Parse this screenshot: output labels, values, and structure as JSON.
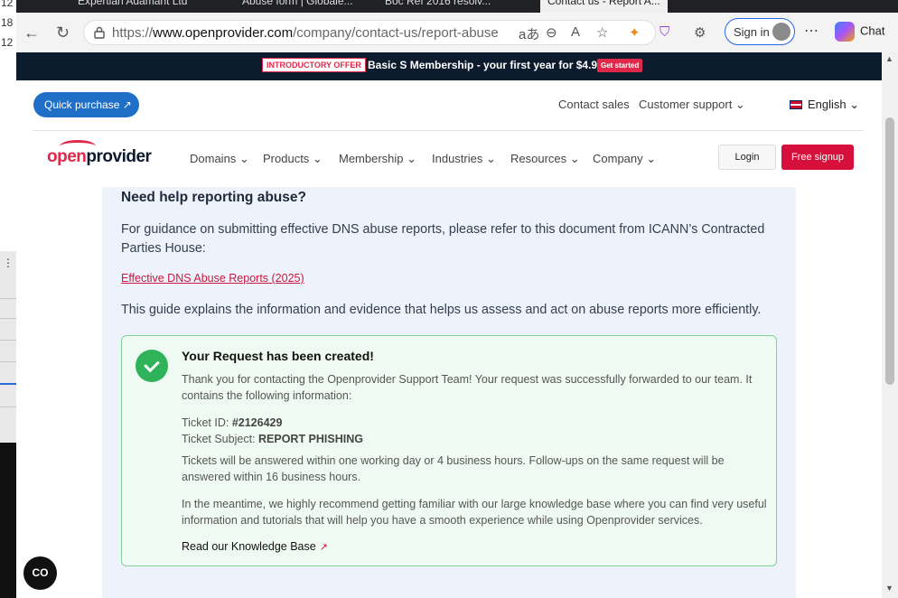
{
  "desktop": {
    "numbers": [
      "12",
      "18",
      "12"
    ],
    "dots": "⋮"
  },
  "tabs": [
    "Expertian Adamant Ltd",
    "Abuse form | Globale...",
    "Boc Ref 2016 resolv...",
    "Contact us - Report A..."
  ],
  "browser": {
    "url_prefix": "https://",
    "url_host": "www.openprovider.com",
    "url_path": "/company/contact-us/report-abuse",
    "signin_label": "Sign in",
    "more_label": "⋯",
    "chat_label": "Chat"
  },
  "promo": {
    "badge": "INTRODUCTORY OFFER",
    "message": "Basic S Membership - your first year for $4.99",
    "cta": "Get started"
  },
  "topbar": {
    "quick_purchase": "Quick purchase ↗",
    "contact_sales": "Contact sales",
    "customer_support": "Customer support ⌄",
    "language": "English ⌄"
  },
  "nav": {
    "logo_open": "open",
    "logo_provider": "provider",
    "items": [
      "Domains ⌄",
      "Products ⌄",
      "Membership ⌄",
      "Industries ⌄",
      "Resources ⌄",
      "Company ⌄"
    ],
    "login": "Login",
    "signup": "Free signup"
  },
  "content": {
    "heading": "Need help reporting abuse?",
    "intro": "For guidance on submitting effective DNS abuse reports, please refer to this document from ICANN’s Contracted Parties House:",
    "link": "Effective DNS Abuse Reports (2025)",
    "guide": "This guide explains the information and evidence that helps us assess and act on abuse reports more efficiently."
  },
  "alert": {
    "title": "Your Request has been created!",
    "thanks": "Thank you for contacting the Openprovider Support Team! Your request was successfully forwarded to our team. It contains the following information:",
    "ticket_id_label": "Ticket ID:",
    "ticket_id": "#2126429",
    "ticket_subject_label": "Ticket Subject:",
    "ticket_subject": "REPORT PHISHING",
    "response_time": "Tickets will be answered within one working day or 4 business hours. Follow-ups on the same request will be answered within 16 business hours.",
    "meantime": "In the meantime, we highly recommend getting familiar with our large knowledge base where you can find very useful information and tutorials that will help you have a smooth experience while using Openprovider services.",
    "kb_link": "Read our Knowledge Base",
    "kb_icon": "↗"
  },
  "cookie_button": "CO"
}
